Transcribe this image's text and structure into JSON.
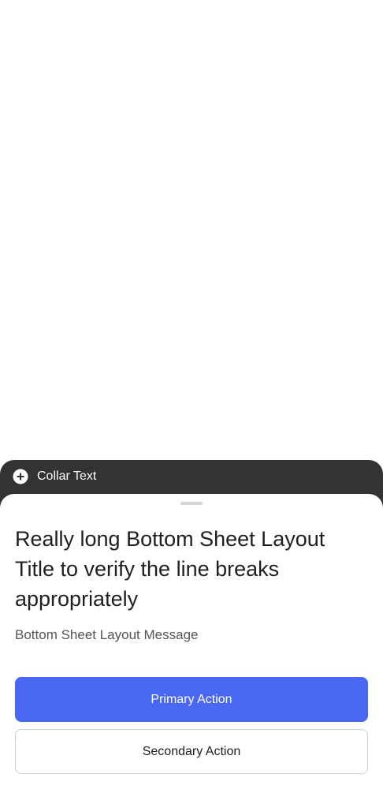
{
  "collar": {
    "icon": "plus-circle-icon",
    "text": "Collar Text"
  },
  "sheet": {
    "title": "Really long Bottom Sheet Layout Title to verify the line breaks appropriately",
    "message": "Bottom Sheet Layout Message",
    "primary_action": "Primary Action",
    "secondary_action": "Secondary Action"
  },
  "colors": {
    "collar_background": "#333333",
    "primary_button": "#4a67f4",
    "secondary_border": "#cfcfcf"
  }
}
